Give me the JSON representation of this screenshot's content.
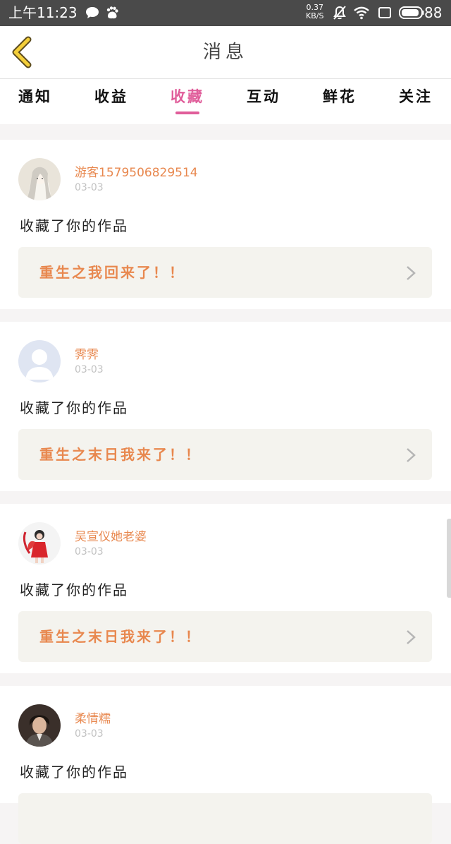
{
  "status_bar": {
    "time": "上午11:23",
    "net_speed_value": "0.37",
    "net_speed_unit": "KB/S",
    "battery": "88",
    "icons": [
      "chat-bubble-icon",
      "baidu-paw-icon",
      "mute-icon",
      "wifi-icon",
      "recent-apps-icon",
      "battery-icon"
    ]
  },
  "header": {
    "title": "消息",
    "back_icon": "chevron-left-icon"
  },
  "tabs": [
    {
      "label": "通知",
      "active": false
    },
    {
      "label": "收益",
      "active": false
    },
    {
      "label": "收藏",
      "active": true
    },
    {
      "label": "互动",
      "active": false
    },
    {
      "label": "鲜花",
      "active": false
    },
    {
      "label": "关注",
      "active": false
    }
  ],
  "accent_color": "#e05d9a",
  "name_color": "#e8884f",
  "messages": [
    {
      "username": "游客1579506829514",
      "date": "03-03",
      "action": "收藏了你的作品",
      "work_title": "重生之我回来了！！",
      "avatar": "anime-avatar"
    },
    {
      "username": "霁霁",
      "date": "03-03",
      "action": "收藏了你的作品",
      "work_title": "重生之末日我来了！！",
      "avatar": "default-avatar"
    },
    {
      "username": "吴宣仪她老婆",
      "date": "03-03",
      "action": "收藏了你的作品",
      "work_title": "重生之末日我来了！！",
      "avatar": "photo-avatar"
    },
    {
      "username": "柔情糯",
      "date": "03-03",
      "action": "收藏了你的作品",
      "work_title": "",
      "avatar": "photo-avatar"
    }
  ]
}
